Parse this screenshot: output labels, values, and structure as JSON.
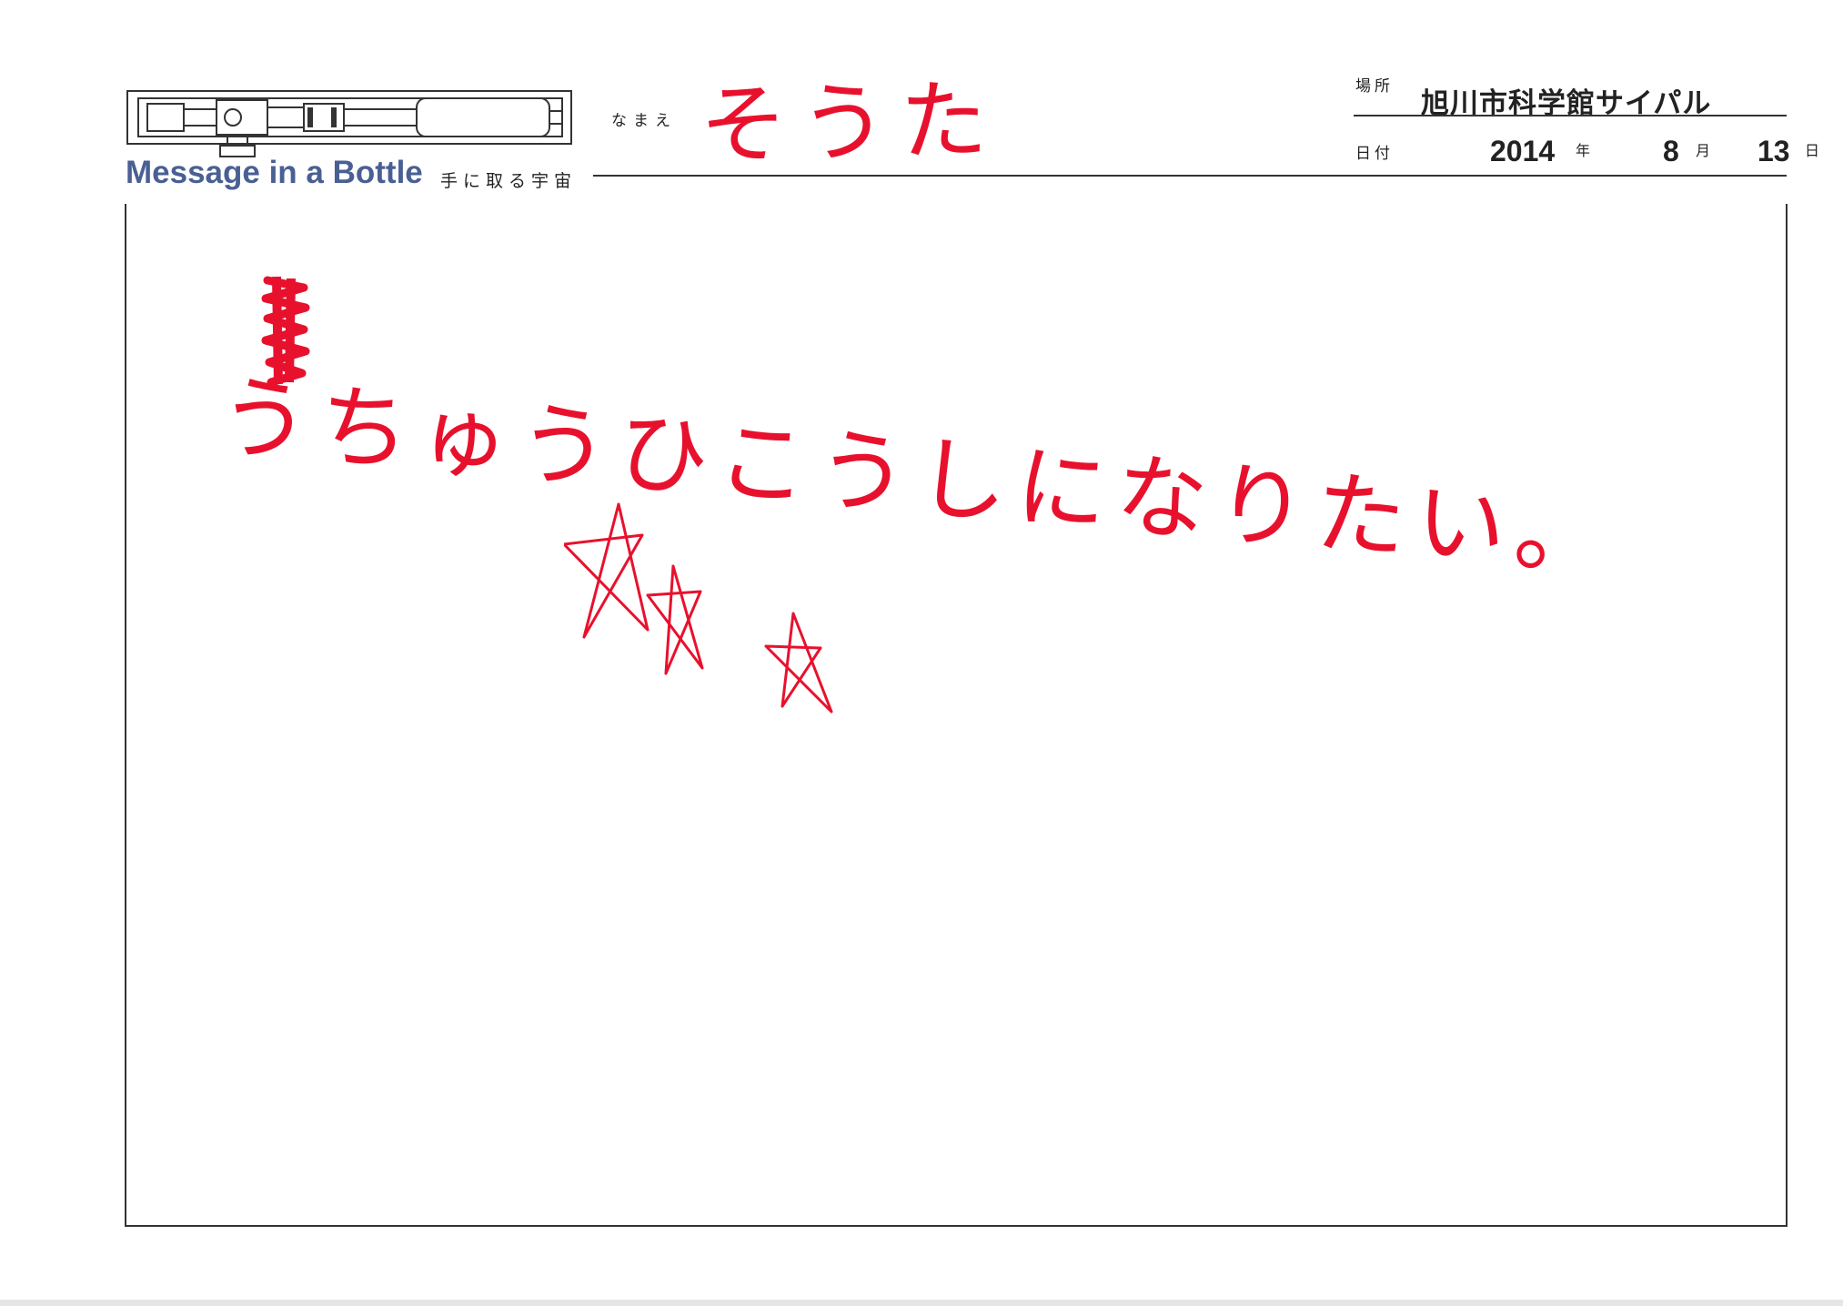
{
  "header": {
    "brand": "Message in a Bottle",
    "tagline": "手に取る宇宙",
    "name_label": "なまえ",
    "place_label": "場所",
    "place_value": "旭川市科学館サイパル",
    "date_label": "日付",
    "date": {
      "year": "2014",
      "year_unit": "年",
      "month": "8",
      "month_unit": "月",
      "day": "13",
      "day_unit": "日"
    }
  },
  "handwriting": {
    "name": "そうた",
    "message": "うちゅうひこうしになりたい。"
  },
  "icons": {
    "logo": "spacecraft-capsule-icon",
    "doodle": "star-doodle-icon",
    "scribble": "scribble-mark-icon"
  },
  "colors": {
    "brand": "#4a5f93",
    "ink": "#e8112d",
    "rule": "#333333"
  }
}
